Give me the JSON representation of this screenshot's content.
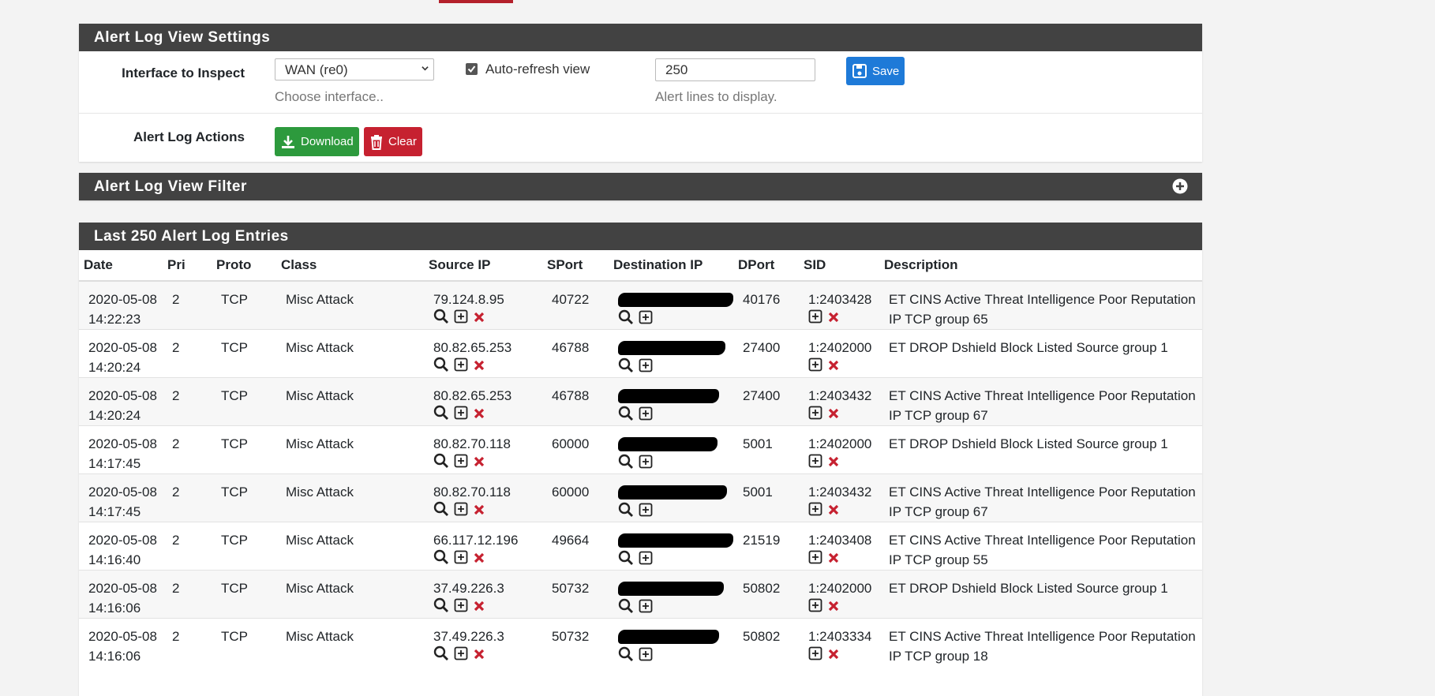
{
  "settings": {
    "title": "Alert Log View Settings",
    "interface_label": "Interface to Inspect",
    "interface_value": "WAN (re0)",
    "interface_help": "Choose interface..",
    "autorefresh_label": "Auto-refresh view",
    "lines_value": "250",
    "lines_help": "Alert lines to display.",
    "save_label": "Save",
    "actions_label": "Alert Log Actions",
    "download_label": "Download",
    "clear_label": "Clear"
  },
  "filter": {
    "title": "Alert Log View Filter"
  },
  "entries": {
    "title": "Last 250 Alert Log Entries",
    "columns": [
      "Date",
      "Pri",
      "Proto",
      "Class",
      "Source IP",
      "SPort",
      "Destination IP",
      "DPort",
      "SID",
      "Description"
    ],
    "rows": [
      {
        "date": "2020-05-08",
        "time": "14:22:23",
        "pri": "2",
        "proto": "TCP",
        "cls": "Misc Attack",
        "src": "79.124.8.95",
        "sport": "40722",
        "dport": "40176",
        "sid": "1:2403428",
        "desc1": "ET CINS Active Threat Intelligence Poor Reputation",
        "desc2": "IP TCP group 65"
      },
      {
        "date": "2020-05-08",
        "time": "14:20:24",
        "pri": "2",
        "proto": "TCP",
        "cls": "Misc Attack",
        "src": "80.82.65.253",
        "sport": "46788",
        "dport": "27400",
        "sid": "1:2402000",
        "desc1": "ET DROP Dshield Block Listed Source group 1",
        "desc2": ""
      },
      {
        "date": "2020-05-08",
        "time": "14:20:24",
        "pri": "2",
        "proto": "TCP",
        "cls": "Misc Attack",
        "src": "80.82.65.253",
        "sport": "46788",
        "dport": "27400",
        "sid": "1:2403432",
        "desc1": "ET CINS Active Threat Intelligence Poor Reputation",
        "desc2": "IP TCP group 67"
      },
      {
        "date": "2020-05-08",
        "time": "14:17:45",
        "pri": "2",
        "proto": "TCP",
        "cls": "Misc Attack",
        "src": "80.82.70.118",
        "sport": "60000",
        "dport": "5001",
        "sid": "1:2402000",
        "desc1": "ET DROP Dshield Block Listed Source group 1",
        "desc2": ""
      },
      {
        "date": "2020-05-08",
        "time": "14:17:45",
        "pri": "2",
        "proto": "TCP",
        "cls": "Misc Attack",
        "src": "80.82.70.118",
        "sport": "60000",
        "dport": "5001",
        "sid": "1:2403432",
        "desc1": "ET CINS Active Threat Intelligence Poor Reputation",
        "desc2": "IP TCP group 67"
      },
      {
        "date": "2020-05-08",
        "time": "14:16:40",
        "pri": "2",
        "proto": "TCP",
        "cls": "Misc Attack",
        "src": "66.117.12.196",
        "sport": "49664",
        "dport": "21519",
        "sid": "1:2403408",
        "desc1": "ET CINS Active Threat Intelligence Poor Reputation",
        "desc2": "IP TCP group 55"
      },
      {
        "date": "2020-05-08",
        "time": "14:16:06",
        "pri": "2",
        "proto": "TCP",
        "cls": "Misc Attack",
        "src": "37.49.226.3",
        "sport": "50732",
        "dport": "50802",
        "sid": "1:2402000",
        "desc1": "ET DROP Dshield Block Listed Source group 1",
        "desc2": ""
      },
      {
        "date": "2020-05-08",
        "time": "14:16:06",
        "pri": "2",
        "proto": "TCP",
        "cls": "Misc Attack",
        "src": "37.49.226.3",
        "sport": "50732",
        "dport": "50802",
        "sid": "1:2403334",
        "desc1": "ET CINS Active Threat Intelligence Poor Reputation",
        "desc2": "IP TCP group 18"
      }
    ]
  },
  "colors": {
    "header_bg": "#424242",
    "save_blue": "#1e7ad8",
    "download_green": "#2d9a3d",
    "clear_red": "#c62130",
    "remove_red": "#c62130"
  },
  "icons": {
    "lookup": "search-icon",
    "add_suppress": "plus-square-icon",
    "remove": "x-icon"
  }
}
